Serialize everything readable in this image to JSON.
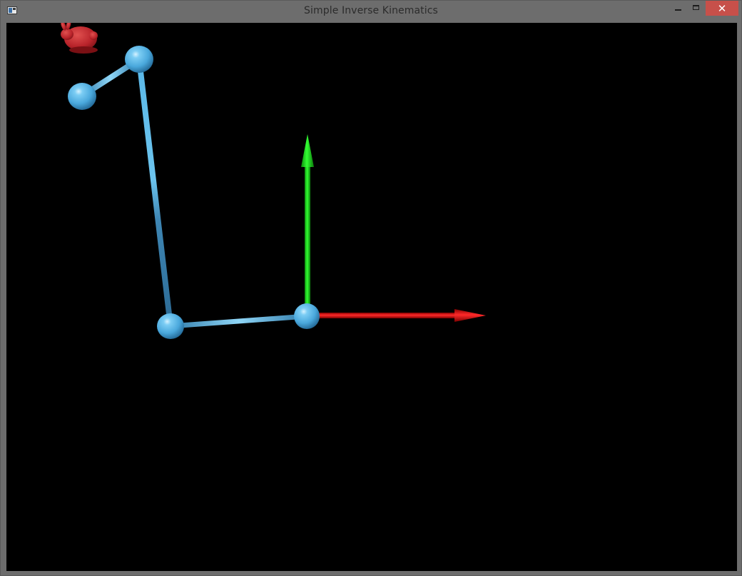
{
  "window": {
    "title": "Simple Inverse Kinematics",
    "close_glyph": "✕"
  },
  "icons": {
    "app": "application-window-icon",
    "minimize": "minimize-icon",
    "maximize": "maximize-icon",
    "close": "close-icon"
  },
  "scene": {
    "background": "#000000",
    "joint_color": "#4fb4e6",
    "bone_color": "#3f8fbf",
    "x_axis_color": "#ff0000",
    "y_axis_color": "#00d000",
    "target_color": "#c8262a",
    "target_model": "bunny"
  }
}
